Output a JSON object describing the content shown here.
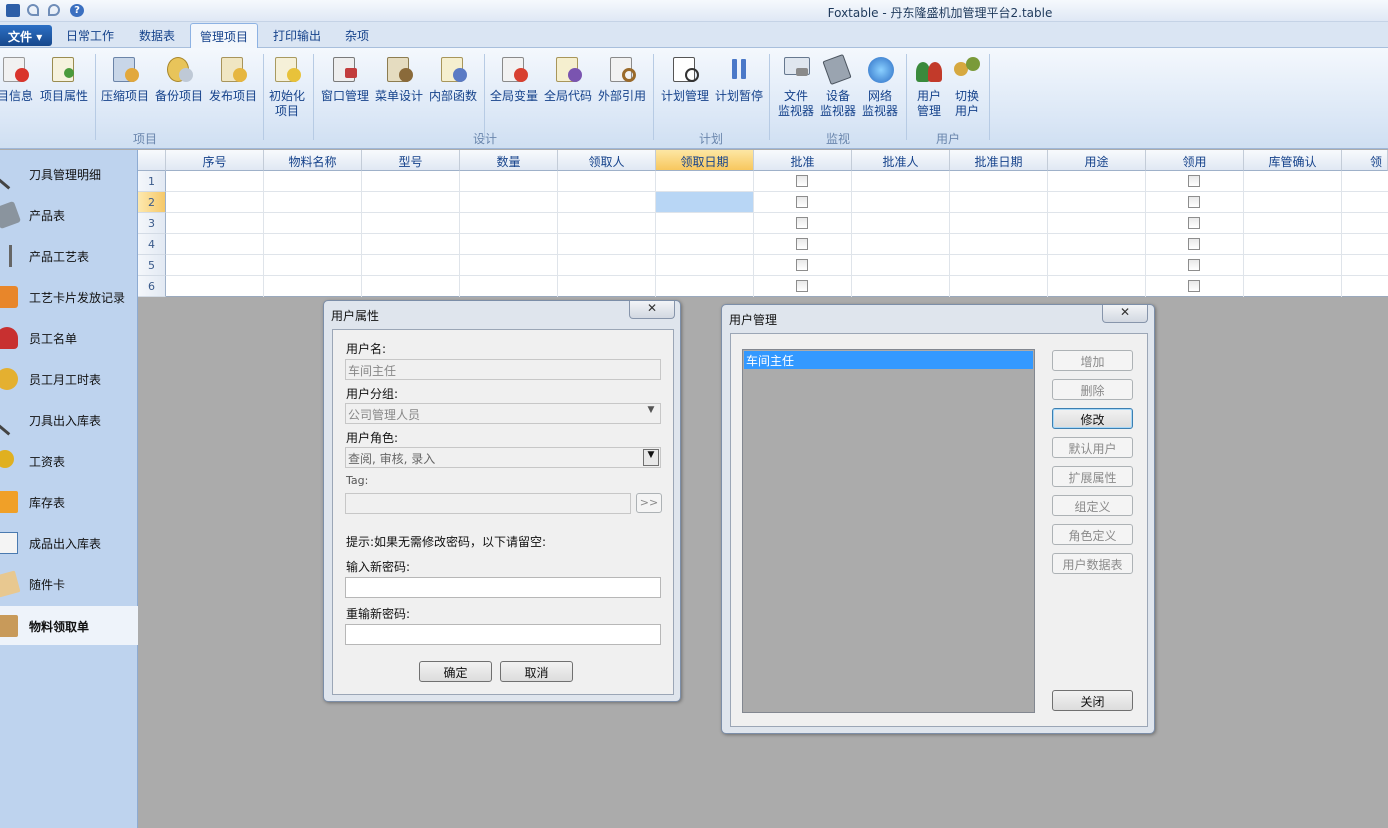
{
  "window": {
    "title": "Foxtable - 丹东隆盛机加管理平台2.table"
  },
  "quick_access": [
    "save-icon",
    "undo-icon",
    "redo-icon",
    "help-icon"
  ],
  "menu": {
    "file_label": "文件",
    "tabs": [
      "日常工作",
      "数据表",
      "管理项目",
      "打印输出",
      "杂项"
    ],
    "active_tab": "管理项目"
  },
  "ribbon": {
    "groups": [
      "项目",
      "设计",
      "计划",
      "监视",
      "用户"
    ],
    "buttons": [
      {
        "label": "目信息",
        "icon": "project-info-icon"
      },
      {
        "label": "项目属性",
        "icon": "project-properties-icon"
      },
      {
        "label": "压缩项目",
        "icon": "compress-project-icon"
      },
      {
        "label": "备份项目",
        "icon": "backup-project-icon"
      },
      {
        "label": "发布项目",
        "icon": "publish-project-icon"
      },
      {
        "label": "初始化",
        "label2": "项目",
        "icon": "initialize-project-icon"
      },
      {
        "label": "窗口管理",
        "icon": "window-manager-icon"
      },
      {
        "label": "菜单设计",
        "icon": "menu-design-icon"
      },
      {
        "label": "内部函数",
        "icon": "internal-functions-icon"
      },
      {
        "label": "全局变量",
        "icon": "global-variables-icon"
      },
      {
        "label": "全局代码",
        "icon": "global-code-icon"
      },
      {
        "label": "外部引用",
        "icon": "external-references-icon"
      },
      {
        "label": "计划管理",
        "icon": "schedule-manager-icon"
      },
      {
        "label": "计划暂停",
        "icon": "pause-icon"
      },
      {
        "label": "文件",
        "label2": "监视器",
        "icon": "file-monitor-icon"
      },
      {
        "label": "设备",
        "label2": "监视器",
        "icon": "device-monitor-icon"
      },
      {
        "label": "网络",
        "label2": "监视器",
        "icon": "network-monitor-icon"
      },
      {
        "label": "用户",
        "label2": "管理",
        "icon": "user-management-icon"
      },
      {
        "label": "切换",
        "label2": "用户",
        "icon": "switch-user-icon"
      }
    ]
  },
  "sidebar": {
    "items": [
      "刀具管理明细",
      "产品表",
      "产品工艺表",
      "工艺卡片发放记录",
      "员工名单",
      "员工月工时表",
      "刀具出入库表",
      "工资表",
      "库存表",
      "成品出入库表",
      "随件卡",
      "物料领取单"
    ],
    "selected": "物料领取单"
  },
  "table": {
    "columns": [
      "序号",
      "物料名称",
      "型号",
      "数量",
      "领取人",
      "领取日期",
      "批准",
      "批准人",
      "批准日期",
      "用途",
      "领用",
      "库管确认",
      "领用"
    ],
    "highlighted_column": "领取日期",
    "rows": [
      "1",
      "2",
      "3",
      "4",
      "5",
      "6"
    ],
    "current_row": "2"
  },
  "user_props_dialog": {
    "title": "用户属性",
    "close_label": "✕",
    "username_label": "用户名:",
    "username_value": "车间主任",
    "group_label": "用户分组:",
    "group_value": "公司管理人员",
    "role_label": "用户角色:",
    "role_value": "查阅, 审核, 录入",
    "tag_label": "Tag:",
    "tag_value": "",
    "tag_button": ">>",
    "hint": "提示:如果无需修改密码，以下请留空:",
    "new_password_label": "输入新密码:",
    "confirm_password_label": "重输新密码:",
    "ok_label": "确定",
    "cancel_label": "取消"
  },
  "user_mgmt_dialog": {
    "title": "用户管理",
    "close_label": "✕",
    "users": [
      "车间主任"
    ],
    "buttons": [
      "增加",
      "删除",
      "修改",
      "默认用户",
      "扩展属性",
      "组定义",
      "角色定义",
      "用户数据表"
    ],
    "close_button": "关闭"
  },
  "colors": {
    "accent": "#15428b",
    "selection": "#3399ff",
    "highlight_col": "#f7c75e",
    "selected_cell": "#b8d6f5"
  }
}
